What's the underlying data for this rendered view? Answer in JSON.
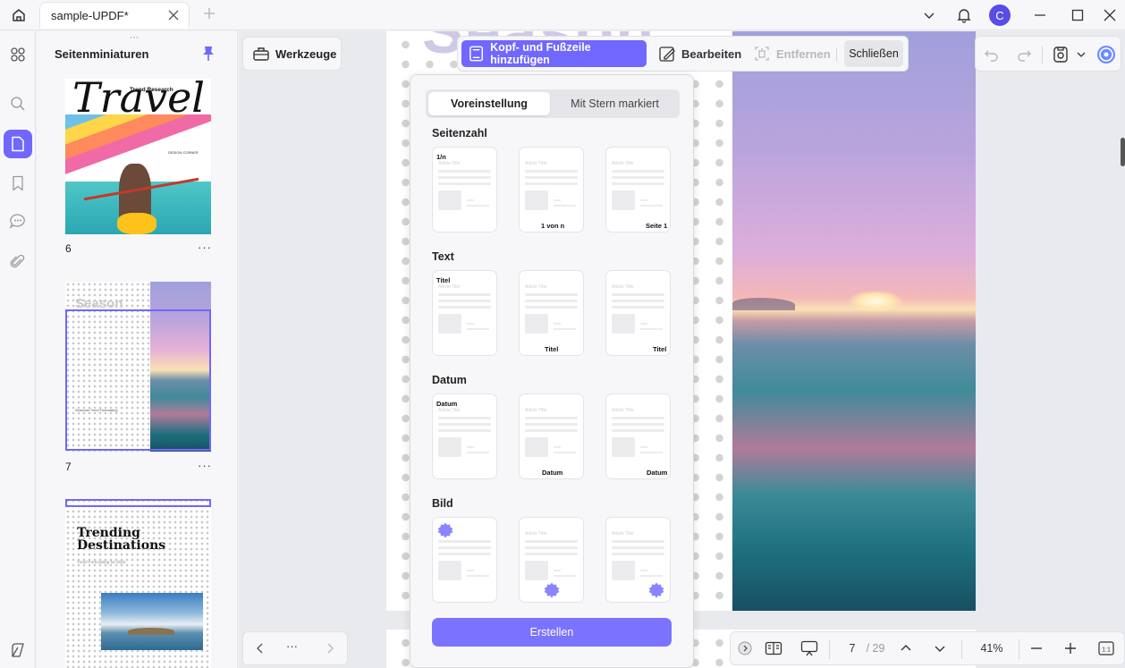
{
  "titlebar": {
    "tab_title": "sample-UPDF*",
    "avatar_letter": "C"
  },
  "thumbnails": {
    "title": "Seitenminiaturen",
    "pages": [
      {
        "number": "6",
        "heading": "Travel",
        "subheading": "Trend Research",
        "caption": "DESIGN CORNER"
      },
      {
        "number": "7",
        "heading": "Season",
        "caption": "Seasonal Trend Forecasting"
      },
      {
        "heading_line1": "Trending",
        "heading_line2": "Destinations",
        "caption": "Trend Forecasting for 2022"
      }
    ],
    "more_glyph": "···"
  },
  "toolbar": {
    "tools_label": "Werkzeuge",
    "add_header_footer": "Kopf- und Fußzeile hinzufügen",
    "edit": "Bearbeiten",
    "remove": "Entfernen",
    "close": "Schließen"
  },
  "page": {
    "background_text": "Season"
  },
  "panel": {
    "tabs": {
      "preset": "Voreinstellung",
      "starred": "Mit Stern markiert"
    },
    "sections": {
      "page_number": {
        "title": "Seitenzahl",
        "labels": [
          "1/n",
          "1 von n",
          "Seite 1"
        ]
      },
      "text": {
        "title": "Text",
        "labels": [
          "Titel",
          "Titel",
          "Titel"
        ]
      },
      "date": {
        "title": "Datum",
        "labels": [
          "Datum",
          "Datum",
          "Datum"
        ]
      },
      "image": {
        "title": "Bild"
      }
    },
    "placeholder_text": "Article Title",
    "create_button": "Erstellen",
    "accent_color": "#7067ff"
  },
  "bottom": {
    "dots": "···",
    "current_page": "7",
    "total_pages": "/ 29",
    "zoom": "41%"
  }
}
